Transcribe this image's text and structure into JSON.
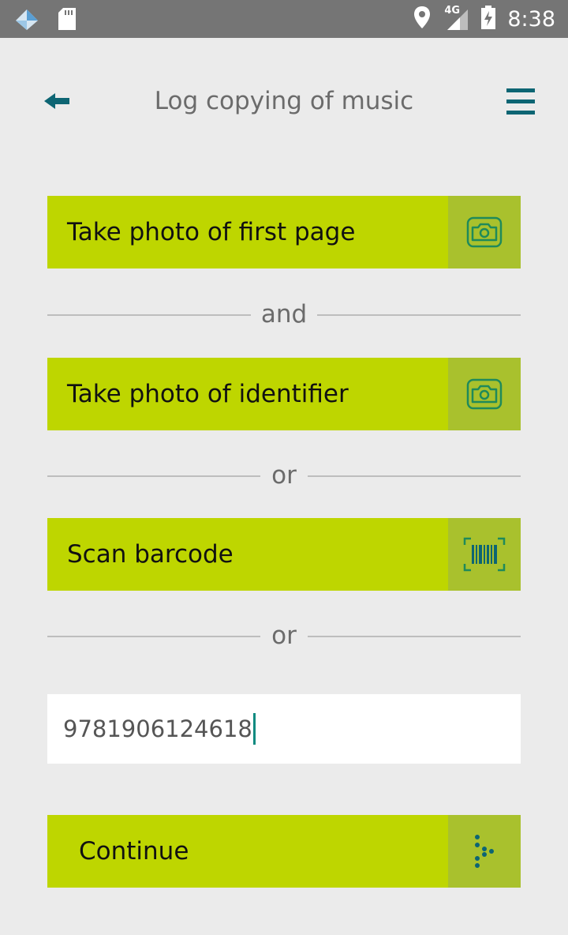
{
  "status_bar": {
    "time": "8:38",
    "network": "4G",
    "icons": [
      "app-notification-icon",
      "sd-card-icon",
      "location-icon",
      "signal-icon",
      "battery-charging-icon"
    ]
  },
  "header": {
    "title": "Log copying of music",
    "icons": [
      "back-arrow-icon",
      "menu-icon"
    ],
    "accent_color": "#0d6573"
  },
  "actions": {
    "photo_first_page": {
      "label": "Take photo of first page",
      "icon": "camera-icon"
    },
    "photo_identifier": {
      "label": "Take photo of identifier",
      "icon": "camera-icon"
    },
    "scan_barcode": {
      "label": "Scan barcode",
      "icon": "barcode-icon"
    },
    "continue": {
      "label": "Continue",
      "icon": "next-dots-icon"
    }
  },
  "dividers": {
    "and": "and",
    "or_1": "or",
    "or_2": "or"
  },
  "isbn_input": {
    "value": "9781906124618"
  },
  "colors": {
    "button": "#bed600",
    "button_icon_bg": "#a9c12d",
    "background": "#ebebeb",
    "status_bar": "#757575"
  }
}
